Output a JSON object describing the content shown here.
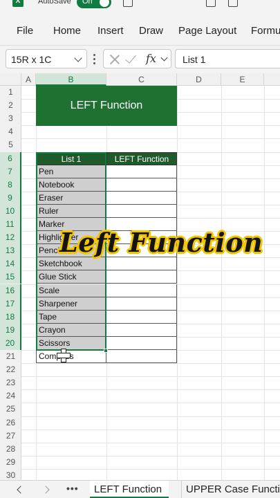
{
  "titlebar": {
    "autosave_label": "AutoSave",
    "toggle_state": "On"
  },
  "menu": {
    "items": [
      "File",
      "Home",
      "Insert",
      "Draw",
      "Page Layout",
      "Formu"
    ]
  },
  "formula_bar": {
    "name_box": "15R x 1C",
    "fx_symbol": "fx",
    "formula_value": "List 1"
  },
  "grid": {
    "columns": [
      "A",
      "B",
      "C",
      "D",
      "E"
    ],
    "rows": [
      "1",
      "2",
      "3",
      "4",
      "5",
      "6",
      "7",
      "8",
      "9",
      "10",
      "11",
      "12",
      "13",
      "14",
      "15",
      "16",
      "17",
      "18",
      "19",
      "20",
      "21",
      "22",
      "23",
      "24",
      "25",
      "26",
      "27",
      "28",
      "29",
      "30"
    ],
    "banner": "LEFT Function",
    "table_headers": {
      "b": "List 1",
      "c": "LEFT Function"
    },
    "list_items": [
      "Pen",
      "Notebook",
      "Eraser",
      "Ruler",
      "Marker",
      "Highlighter",
      "Pencil",
      "Sketchbook",
      "Glue Stick",
      "Scale",
      "Sharpener",
      "Tape",
      "Crayon",
      "Scissors",
      "Compass"
    ]
  },
  "overlay": {
    "title": "Left Function"
  },
  "sheet_tabs": {
    "active": "LEFT Function",
    "inactive": "UPPER Case Functio",
    "more": "•••"
  },
  "colors": {
    "accent": "#107c41",
    "banner": "#1e7130",
    "header_dark": "#1e5a2a",
    "overlay_outline": "#f2c400"
  }
}
